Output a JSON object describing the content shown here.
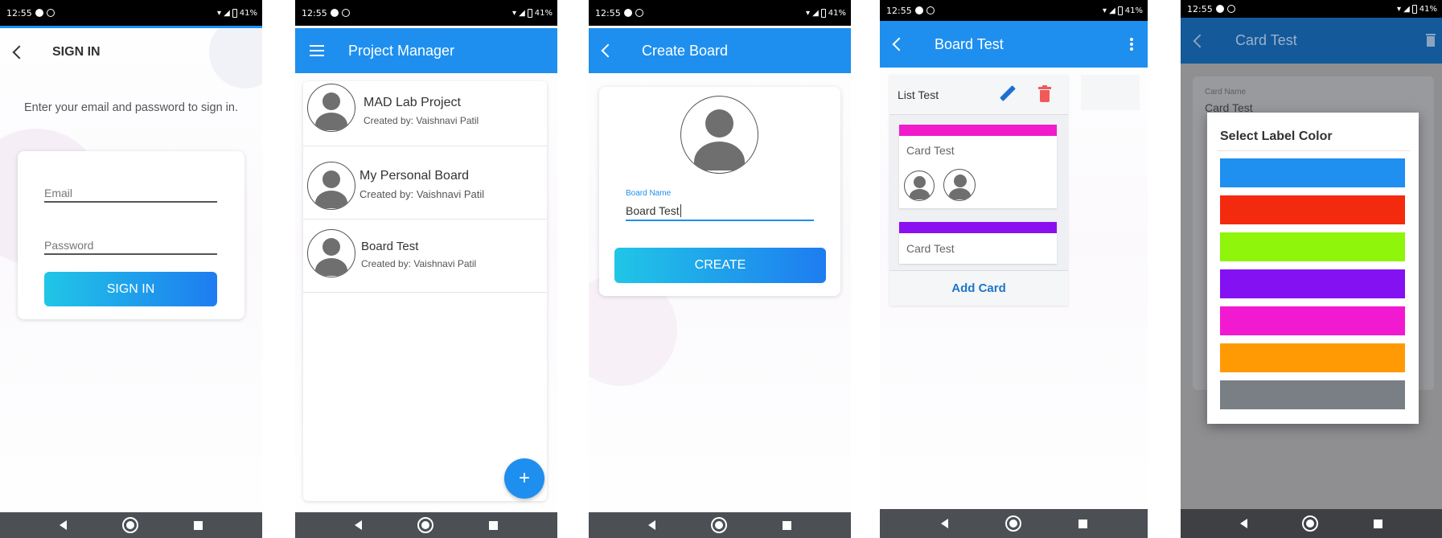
{
  "status": {
    "time": "12:55",
    "battery": "41%",
    "network": "4G"
  },
  "screen1": {
    "title": "SIGN IN",
    "subtitle": "Enter your email and password to sign in.",
    "email_placeholder": "Email",
    "password_placeholder": "Password",
    "button": "SIGN IN"
  },
  "screen2": {
    "title": "Project Manager",
    "boards": [
      {
        "name": "MAD Lab Project",
        "creator": "Created by: Vaishnavi Patil"
      },
      {
        "name": "My Personal Board",
        "creator": "Created by: Vaishnavi Patil"
      },
      {
        "name": "Board Test",
        "creator": "Created by: Vaishnavi Patil"
      }
    ],
    "fab": "+"
  },
  "screen3": {
    "title": "Create Board",
    "field_label": "Board Name",
    "field_value": "Board Test",
    "button": "CREATE"
  },
  "screen4": {
    "title": "Board Test",
    "list_title": "List Test",
    "cards": [
      {
        "name": "Card Test",
        "label_color": "#f01ccb"
      },
      {
        "name": "Card Test",
        "label_color": "#8a10f0"
      }
    ],
    "add_card": "Add Card"
  },
  "screen5": {
    "title": "Card Test",
    "card_name_label": "Card Name",
    "card_name_value": "Card Test",
    "dialog_title": "Select Label Color",
    "colors": [
      "#1f8ff0",
      "#f42a0e",
      "#8ef50b",
      "#8411f2",
      "#f21ad0",
      "#ff9a05",
      "#7a7e85"
    ]
  },
  "colors": {
    "primary": "#1e8fef",
    "accent_gradient_start": "#20c6e6",
    "accent_gradient_end": "#1e7cf0",
    "delete": "#f25a5a"
  }
}
